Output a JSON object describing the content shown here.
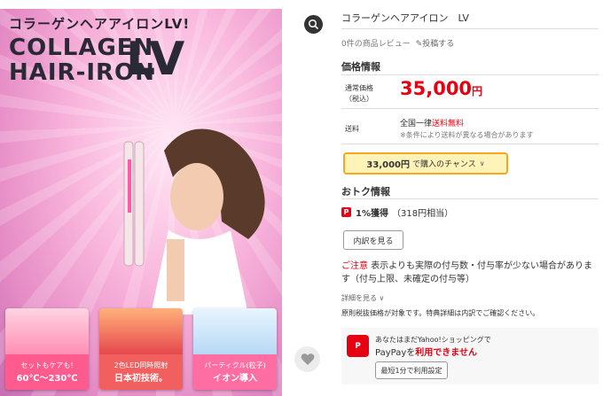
{
  "promo": {
    "tagline": "コラーゲンヘアアイロンLV!",
    "brand_line1": "COLLAGEN",
    "brand_line2": "HAIR-IRON",
    "brand_model": "LV",
    "tiles": [
      {
        "line1": "セットもケアも!",
        "line2": "60℃〜230℃"
      },
      {
        "line1": "2色LED同時照射",
        "line2": "日本初技術。"
      },
      {
        "line1": "パーティクル(粒子)",
        "line2": "イオン導入"
      }
    ]
  },
  "icons": {
    "zoom": "zoom-icon",
    "favorite": "heart-icon",
    "coupon": "paypay-icon"
  },
  "product": {
    "title": "コラーゲンヘアアイロン　LV",
    "review_count_text": "0件の商品レビュー",
    "post_review": "投稿する"
  },
  "price_info": {
    "heading": "価格情報",
    "regular_label": "通常価格（税込）",
    "price": "35,000",
    "price_unit": "円",
    "shipping_label": "送料",
    "shipping_prefix": "全国一律",
    "shipping_free": "送料無料",
    "shipping_note": "※条件により送料が異なる場合があります",
    "chance_amount": "33,000円",
    "chance_text": "で購入のチャンス",
    "chance_chevron": "∨"
  },
  "deals": {
    "heading": "おトク情報",
    "paypay_percent": "1%獲得",
    "paypay_equiv": "（318円相当）",
    "breakdown_button": "内訳を見る",
    "notice_red": "ご注意",
    "notice_text": "表示よりも実際の付与数・付与率が少ない場合があります（付与上限、未確定の付与等）",
    "details_link": "詳細を見る ∨",
    "tax_note": "原則税抜価格が対象です。特典詳細は内訳でご確認ください。"
  },
  "paypay": {
    "logo": "P",
    "line1": "あなたはまだYahoo!ショッピングで",
    "line2_prefix": "PayPayを",
    "line2_red": "利用できません",
    "button": "最短1分で利用設定"
  },
  "colors": {
    "accent_red": "#e60012",
    "chance_border": "#f5a623",
    "chance_bg": "#fff3b8"
  }
}
